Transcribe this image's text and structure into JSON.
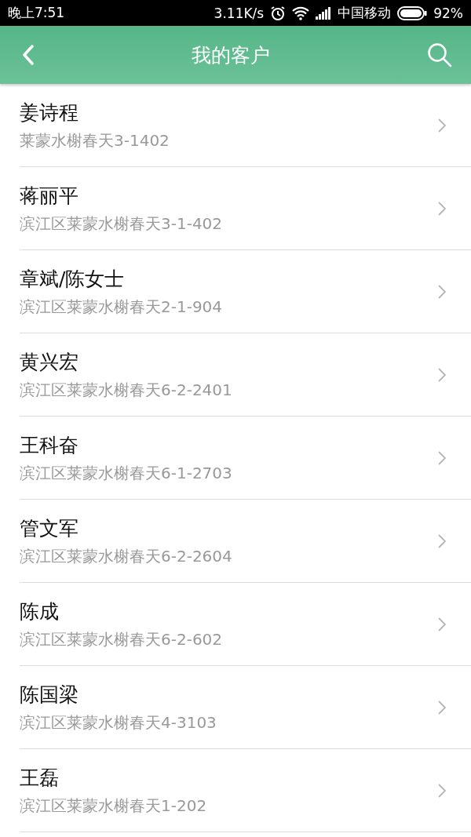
{
  "status_bar": {
    "time": "晚上7:51",
    "speed": "3.11K/s",
    "carrier": "中国移动",
    "battery": "92%"
  },
  "header": {
    "title": "我的客户"
  },
  "customers": [
    {
      "name": "姜诗程",
      "address": "莱蒙水榭春天3-1402"
    },
    {
      "name": "蒋丽平",
      "address": "滨江区莱蒙水榭春天3-1-402"
    },
    {
      "name": "章斌/陈女士",
      "address": "滨江区莱蒙水榭春天2-1-904"
    },
    {
      "name": "黄兴宏",
      "address": "滨江区莱蒙水榭春天6-2-2401"
    },
    {
      "name": "王科奋",
      "address": "滨江区莱蒙水榭春天6-1-2703"
    },
    {
      "name": "管文军",
      "address": "滨江区莱蒙水榭春天6-2-2604"
    },
    {
      "name": "陈成",
      "address": "滨江区莱蒙水榭春天6-2-602"
    },
    {
      "name": "陈国梁",
      "address": "滨江区莱蒙水榭春天4-3103"
    },
    {
      "name": "王磊",
      "address": "滨江区莱蒙水榭春天1-202"
    }
  ]
}
